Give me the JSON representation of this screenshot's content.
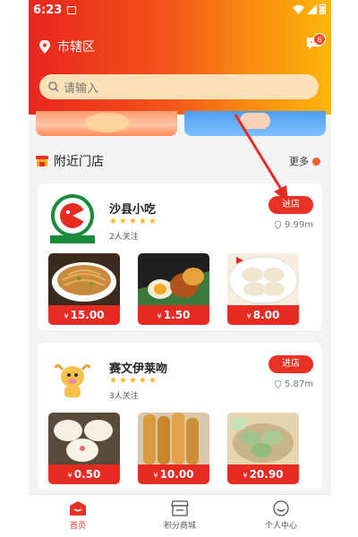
{
  "statusbar": {
    "time": "6:23"
  },
  "header": {
    "location": "市辖区",
    "message_count": "6",
    "search_placeholder": "请输入"
  },
  "section": {
    "title": "附近门店",
    "more": "更多"
  },
  "shops": [
    {
      "name": "沙县小吃",
      "stars": "★★★★★",
      "followers": "2人关注",
      "enter_label": "进店",
      "distance": "9.99m",
      "items": [
        {
          "price": "15.00",
          "currency": "¥",
          "food": "fried-noodles"
        },
        {
          "price": "1.50",
          "currency": "¥",
          "food": "braised-eggs"
        },
        {
          "price": "8.00",
          "currency": "¥",
          "food": "dumplings"
        }
      ]
    },
    {
      "name": "赛文伊莱吻",
      "stars": "★★★★★",
      "followers": "3人关注",
      "enter_label": "进店",
      "distance": "5.87m",
      "items": [
        {
          "price": "0.50",
          "currency": "¥",
          "food": "steamed-buns"
        },
        {
          "price": "10.00",
          "currency": "¥",
          "food": "fried-dough-sticks"
        },
        {
          "price": "20.90",
          "currency": "¥",
          "food": "green-dumplings"
        }
      ]
    }
  ],
  "tabs": [
    {
      "label": "首页",
      "icon": "home-icon",
      "active": true
    },
    {
      "label": "积分商城",
      "icon": "store-icon",
      "active": false
    },
    {
      "label": "个人中心",
      "icon": "profile-icon",
      "active": false
    }
  ],
  "colors": {
    "accent": "#e83024",
    "header_start": "#e8261e",
    "header_end": "#fdb60b",
    "star": "#f9b81a"
  }
}
